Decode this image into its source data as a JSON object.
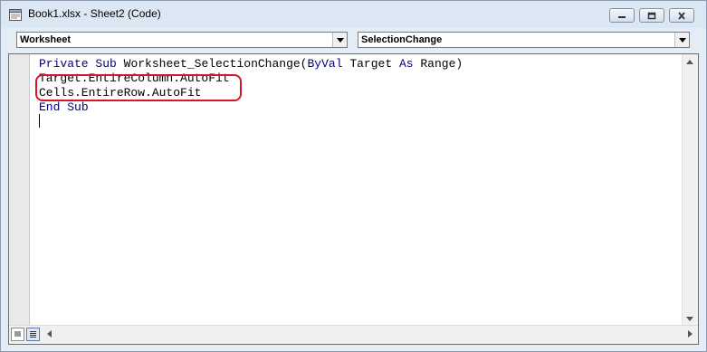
{
  "window": {
    "title": "Book1.xlsx - Sheet2 (Code)",
    "buttons": {
      "minimize": "minimize-icon",
      "restore": "restore-icon",
      "close": "close-icon"
    }
  },
  "toolbar": {
    "object_combo": "Worksheet",
    "procedure_combo": "SelectionChange"
  },
  "code": {
    "line1_kw1": "Private",
    "line1_kw2": "Sub",
    "line1_name": "Worksheet_SelectionChange(",
    "line1_kw3": "ByVal",
    "line1_param": "Target",
    "line1_kw4": "As",
    "line1_type": "Range)",
    "line2": "Target.EntireColumn.AutoFit",
    "line3": "Cells.EntireRow.AutoFit",
    "line4_kw1": "End",
    "line4_kw2": "Sub"
  },
  "colors": {
    "keyword": "#00007f",
    "highlight_border": "#d8132c",
    "title_bar": "#dce7f4"
  },
  "icons": [
    "excel-app-icon",
    "minimize-icon",
    "restore-icon",
    "close-icon",
    "dropdown-arrow-icon",
    "scroll-up-arrow-icon",
    "scroll-down-arrow-icon",
    "scroll-left-arrow-icon",
    "scroll-right-arrow-icon",
    "procedure-view-icon",
    "full-module-view-icon"
  ]
}
